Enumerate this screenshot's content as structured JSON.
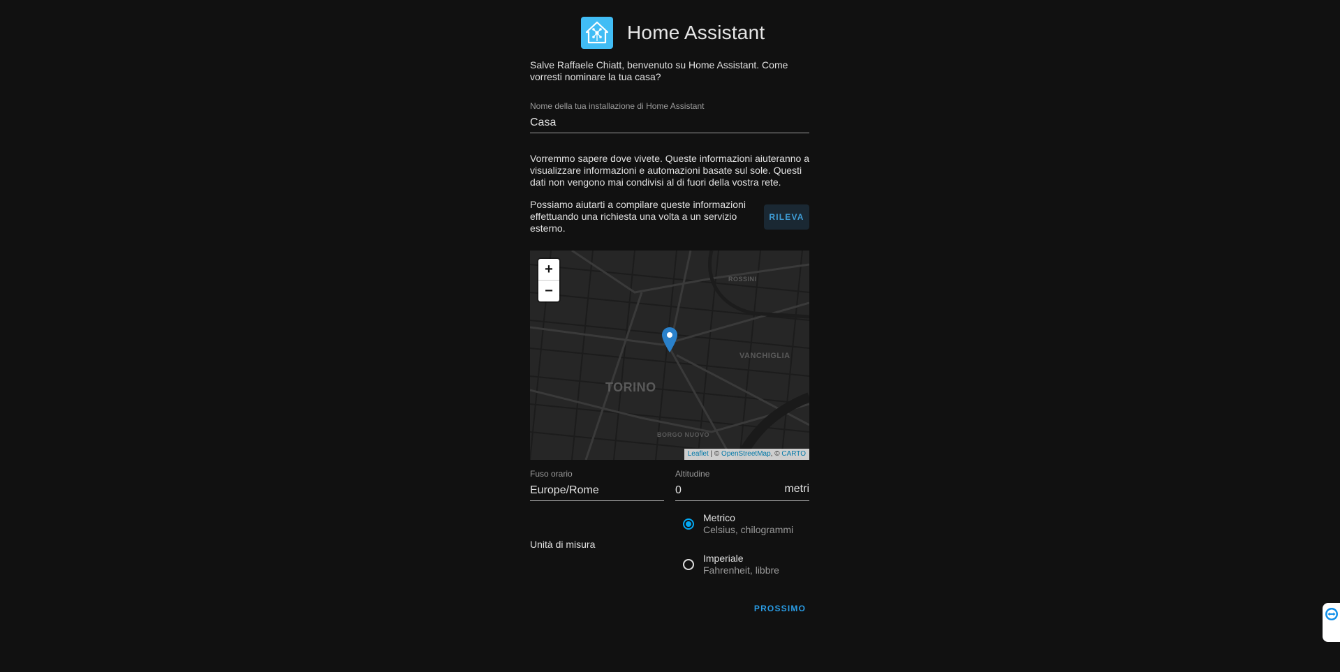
{
  "app": {
    "title": "Home Assistant"
  },
  "intro": {
    "text": "Salve Raffaele Chiatt, benvenuto su Home Assistant. Come vorresti nominare la tua casa?"
  },
  "name_field": {
    "label": "Nome della tua installazione di Home Assistant",
    "value": "Casa"
  },
  "location": {
    "info_text": "Vorremmo sapere dove vivete. Queste informazioni aiuteranno a visualizzare informazioni e automazioni basate sul sole. Questi dati non vengono mai condivisi al di fuori della vostra rete.",
    "detect_text": "Possiamo aiutarti a compilare queste informazioni effettuando una richiesta una volta a un servizio esterno.",
    "detect_button": "RILEVA"
  },
  "map": {
    "zoom_in": "+",
    "zoom_out": "−",
    "labels": {
      "city": "TORINO",
      "district_1": "VANCHIGLIA",
      "district_2": "ROSSINI",
      "district_3": "BORGO NUOVO"
    },
    "attribution": {
      "leaflet": "Leaflet",
      "sep1": " | © ",
      "osm": "OpenStreetMap",
      "sep2": ", © ",
      "carto": "CARTO"
    }
  },
  "timezone_field": {
    "label": "Fuso orario",
    "value": "Europe/Rome"
  },
  "elevation_field": {
    "label": "Altitudine",
    "value": "0",
    "suffix": "metri"
  },
  "units": {
    "label": "Unità di misura",
    "options": [
      {
        "title": "Metrico",
        "subtitle": "Celsius, chilogrammi",
        "checked": true
      },
      {
        "title": "Imperiale",
        "subtitle": "Fahrenheit, libbre",
        "checked": false
      }
    ]
  },
  "actions": {
    "next": "PROSSIMO"
  },
  "colors": {
    "accent": "#03a9f4",
    "logo": "#41bdf5",
    "background": "#111111"
  },
  "icons": {
    "logo": "home-assistant-logo-icon",
    "marker": "map-marker-icon",
    "side_widget": "teamviewer-icon"
  }
}
